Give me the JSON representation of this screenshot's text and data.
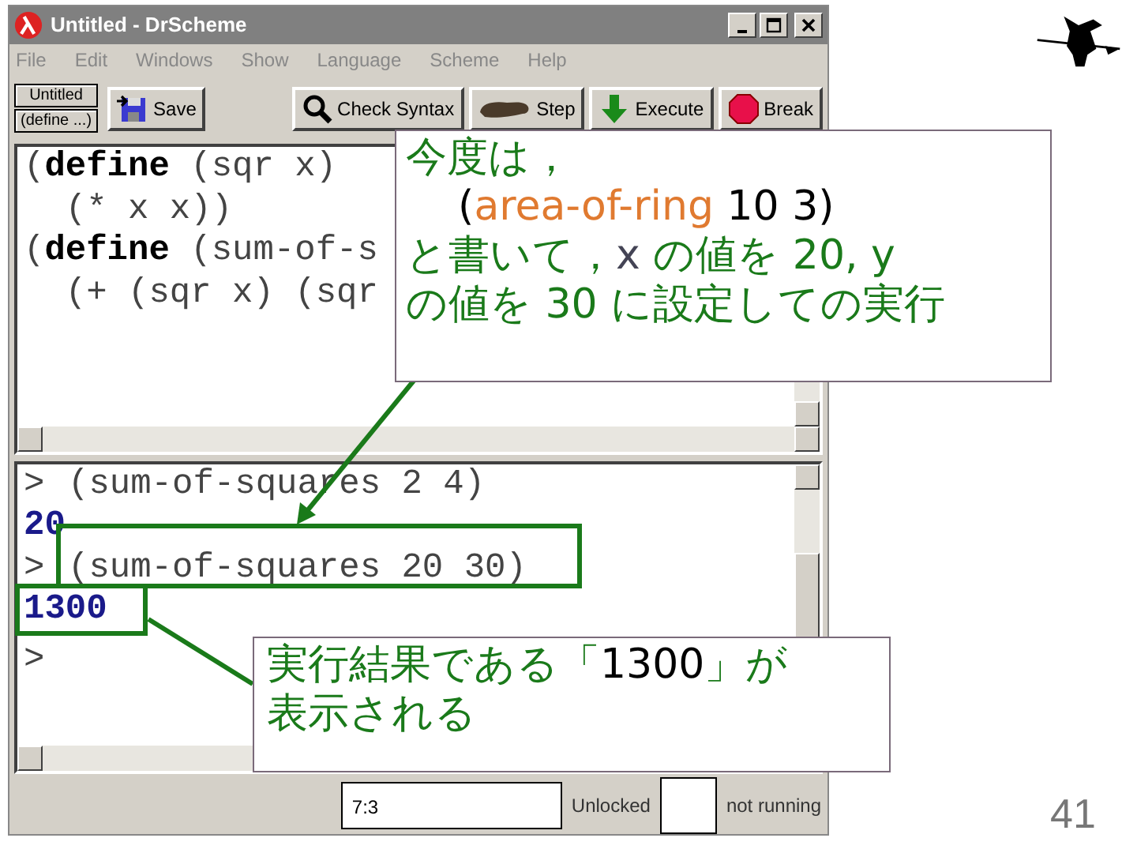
{
  "window": {
    "title": "Untitled - DrScheme"
  },
  "menu": [
    "File",
    "Edit",
    "Windows",
    "Show",
    "Language",
    "Scheme",
    "Help"
  ],
  "toolbar": {
    "name_buttons": [
      "Untitled",
      "(define ...)"
    ],
    "save": "Save",
    "actions": [
      {
        "kind": "check",
        "label": "Check Syntax"
      },
      {
        "kind": "step",
        "label": "Step"
      },
      {
        "kind": "execute",
        "label": "Execute"
      },
      {
        "kind": "break",
        "label": "Break"
      }
    ]
  },
  "definitions": [
    "(**define** (sqr x)",
    "  (* x x))",
    "(**define** (sum-of-s",
    "  (+ (sqr x) (sqr"
  ],
  "interactions": [
    {
      "kind": "input",
      "prompt": ">",
      "text": "(sum-of-squares 2 4)"
    },
    {
      "kind": "output",
      "text": "20"
    },
    {
      "kind": "input",
      "prompt": ">",
      "text": "(sum-of-squares 20 30)"
    },
    {
      "kind": "output",
      "text": "1300"
    },
    {
      "kind": "input",
      "prompt": ">"
    }
  ],
  "status_bar": {
    "position": "7:3",
    "lock": "Unlocked",
    "state": "not running"
  },
  "callouts": [
    {
      "lines": [
        [
          {
            "kind": "note",
            "text": "今度は，"
          }
        ],
        [
          {
            "kind": "value",
            "text": "    ("
          },
          {
            "kind": "code",
            "text": "area-of-ring"
          },
          {
            "kind": "value",
            "text": " 10 3)"
          }
        ],
        [
          {
            "kind": "note",
            "text": "と書いて，"
          },
          {
            "kind": "var",
            "text": "x"
          },
          {
            "kind": "note",
            "text": " の値を 20, y"
          }
        ],
        [
          {
            "kind": "note",
            "text": "の値を 30 に設定しての実行"
          }
        ]
      ]
    },
    {
      "lines": [
        [
          {
            "kind": "note",
            "text": "実行結果である「"
          },
          {
            "kind": "value",
            "text": "1300"
          },
          {
            "kind": "note",
            "text": "」が"
          }
        ],
        [
          {
            "kind": "note",
            "text": "表示される"
          }
        ]
      ]
    }
  ],
  "page_number": "41"
}
